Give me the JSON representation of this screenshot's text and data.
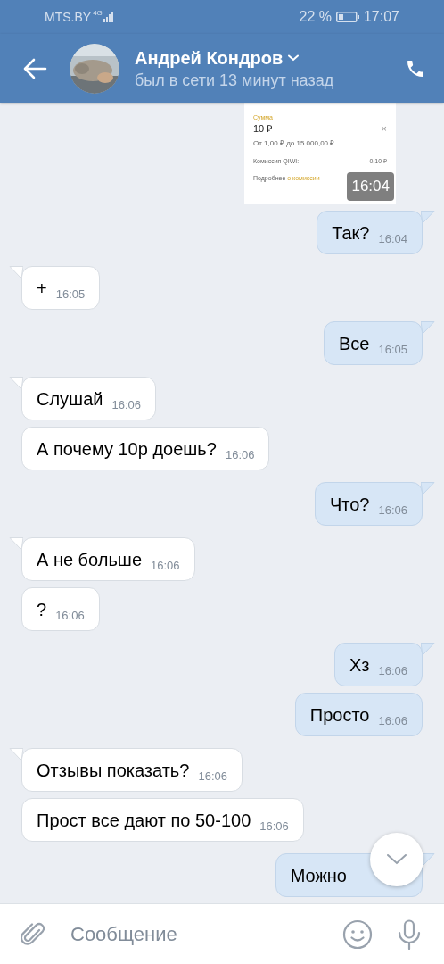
{
  "status_bar": {
    "carrier": "MTS.BY",
    "network": "4G",
    "battery": "22 %",
    "time": "17:07"
  },
  "header": {
    "name": "Андрей Кондров",
    "status": "был в сети 13 минут назад"
  },
  "messages": [
    {
      "kind": "qiwi_screenshot",
      "outgoing": true,
      "amount_label": "Сумма",
      "amount": "10 ₽",
      "clear": "×",
      "range": "От 1,00 ₽ до 15 000,00 ₽",
      "fee_label": "Комиссия QIWI:",
      "fee": "0,10 ₽",
      "more_text": "Подробнее",
      "more_link": "о комиссии",
      "time": "16:04"
    },
    {
      "kind": "text",
      "outgoing": true,
      "text": "Так?",
      "time": "16:04"
    },
    {
      "kind": "text",
      "outgoing": false,
      "text": "+",
      "time": "16:05"
    },
    {
      "kind": "text",
      "outgoing": true,
      "text": "Все",
      "time": "16:05"
    },
    {
      "kind": "text",
      "outgoing": false,
      "text": "Слушай",
      "time": "16:06"
    },
    {
      "kind": "text",
      "outgoing": false,
      "text": "А почему 10р доешь?",
      "time": "16:06"
    },
    {
      "kind": "text",
      "outgoing": true,
      "text": "Что?",
      "time": "16:06"
    },
    {
      "kind": "text",
      "outgoing": false,
      "text": "А не больше",
      "time": "16:06"
    },
    {
      "kind": "text",
      "outgoing": false,
      "text": "?",
      "time": "16:06"
    },
    {
      "kind": "text",
      "outgoing": true,
      "text": "Хз",
      "time": "16:06"
    },
    {
      "kind": "text",
      "outgoing": true,
      "text": "Просто",
      "time": "16:06"
    },
    {
      "kind": "text",
      "outgoing": false,
      "text": "Отзывы показать?",
      "time": "16:06"
    },
    {
      "kind": "text",
      "outgoing": false,
      "text": "Прост все дают по 50-100",
      "time": "16:06"
    },
    {
      "kind": "text",
      "outgoing": true,
      "text": "Можно"
    }
  ],
  "composer": {
    "placeholder": "Сообщение"
  }
}
